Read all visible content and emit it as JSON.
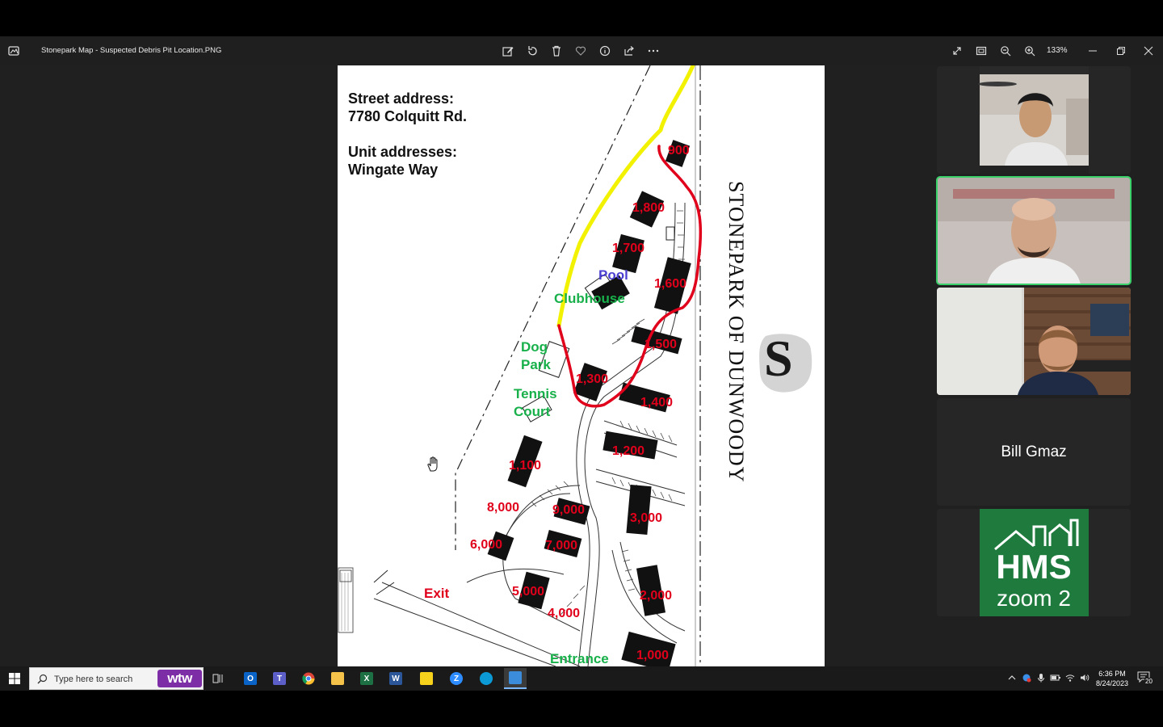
{
  "window": {
    "title": "Stonepark Map - Suspected Debris Pit Location.PNG",
    "zoom": "133%"
  },
  "toolbar": {
    "icons": [
      "edit-icon",
      "rotate-icon",
      "delete-icon",
      "favorite-icon",
      "info-icon",
      "share-icon",
      "more-icon"
    ],
    "right_icons": [
      "fullscreen-icon",
      "fit-icon",
      "zoom-out-icon",
      "zoom-in-icon"
    ],
    "window_controls": [
      "minimize-icon",
      "restore-icon",
      "close-icon"
    ]
  },
  "map": {
    "street_heading": "Street address:",
    "street": "7780 Colquitt Rd.",
    "unit_heading": "Unit addresses:",
    "unit_street": "Wingate Way",
    "vertical_title": "STONEPARK OF DUNWOODY",
    "logo_letter": "S",
    "units": [
      "900",
      "1,800",
      "1,700",
      "1,600",
      "1,500",
      "1,300",
      "1,400",
      "1,200",
      "1,100",
      "8,000",
      "9,000",
      "3,000",
      "6,000",
      "7,000",
      "5,000",
      "4,000",
      "2,000",
      "1,000"
    ],
    "amenities": {
      "pool": "Pool",
      "clubhouse": "Clubhouse",
      "dog_park_1": "Dog",
      "dog_park_2": "Park",
      "tennis_1": "Tennis",
      "tennis_2": "Court",
      "exit": "Exit",
      "entrance": "Entrance"
    },
    "colors": {
      "highlight_yellow": "#f2f200",
      "outline_red": "#e0001b",
      "unit_red": "#e0001b",
      "amenity_green": "#18b04a",
      "pool_blue": "#4a3fd0"
    }
  },
  "gallery": {
    "participant_name": "Bill Gmaz",
    "brand_top": "HMS",
    "brand_bottom": "zoom 2",
    "active_color": "#3bd16a"
  },
  "taskbar": {
    "search_placeholder": "Type here to search",
    "wtw_label": "wtw",
    "time": "6:36 PM",
    "date": "8/24/2023",
    "notification_count": "20"
  }
}
